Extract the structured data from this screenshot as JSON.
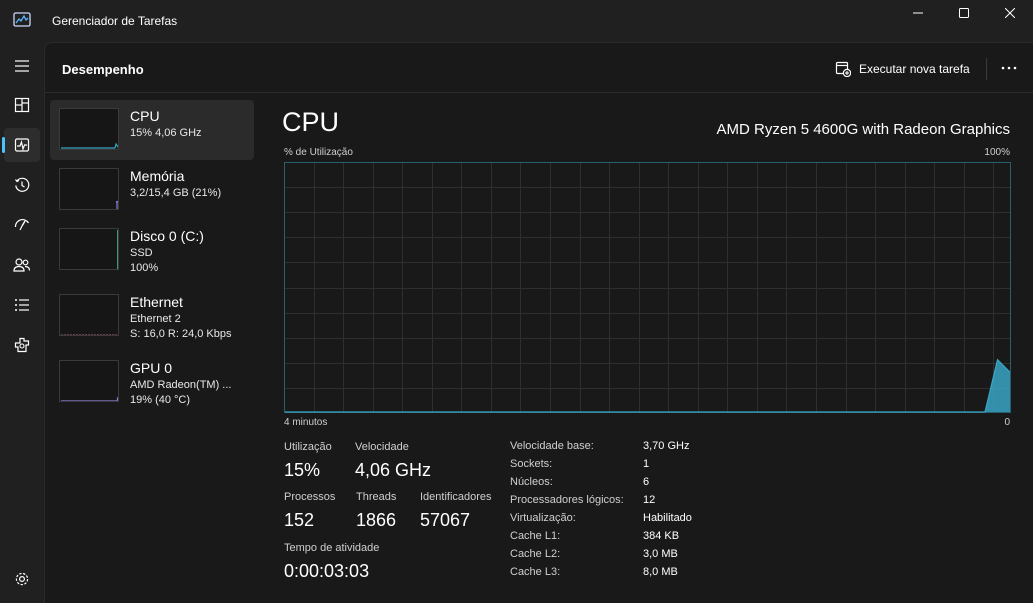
{
  "window": {
    "title": "Gerenciador de Tarefas",
    "icons": {
      "app": "task-manager-icon",
      "minimize": "minimize-icon",
      "maximize": "maximize-icon",
      "close": "close-icon"
    }
  },
  "rail": {
    "icons": [
      "hamburger-menu-icon",
      "processes-icon",
      "performance-icon",
      "app-history-icon",
      "startup-apps-icon",
      "users-icon",
      "details-icon",
      "services-icon",
      "settings-icon"
    ],
    "active": "performance"
  },
  "header": {
    "title": "Desempenho",
    "run_new_task": "Executar nova tarefa",
    "more": "more-options-icon"
  },
  "devices": [
    {
      "name": "CPU",
      "line1": "15% 4,06 GHz",
      "line2": "",
      "color": "#3aa5c4"
    },
    {
      "name": "Memória",
      "line1": "3,2/15,4 GB (21%)",
      "line2": "",
      "color": "#8f80e0"
    },
    {
      "name": "Disco 0 (C:)",
      "line1": "SSD",
      "line2": "100%",
      "color": "#49b89c"
    },
    {
      "name": "Ethernet",
      "line1": "Ethernet 2",
      "line2": "S: 16,0 R: 24,0 Kbps",
      "color": "#c25a8e"
    },
    {
      "name": "GPU 0",
      "line1": "AMD Radeon(TM) ...",
      "line2": "19% (40 °C)",
      "color": "#8f80e0"
    }
  ],
  "cpu": {
    "title": "CPU",
    "model": "AMD Ryzen 5 4600G with Radeon Graphics",
    "util_label": "% de Utilização",
    "util_max": "100%",
    "time_left": "4 minutos",
    "time_right": "0",
    "graph_color": "#3aa5c4",
    "utilization_history": [
      0,
      0,
      0,
      0,
      0,
      0,
      0,
      0,
      0,
      0,
      0,
      0,
      0,
      0,
      0,
      0,
      0,
      0,
      0,
      0,
      0,
      0,
      0,
      0,
      0,
      0,
      0,
      0,
      0,
      0,
      0,
      0,
      0,
      0,
      0,
      0,
      0,
      0,
      0,
      0,
      0,
      0,
      0,
      0,
      0,
      0,
      0,
      0,
      0,
      0,
      0,
      0,
      0,
      0,
      0,
      0,
      0,
      21,
      16
    ],
    "stats": {
      "utilization_label": "Utilização",
      "utilization": "15%",
      "speed_label": "Velocidade",
      "speed": "4,06 GHz",
      "processes_label": "Processos",
      "processes": "152",
      "threads_label": "Threads",
      "threads": "1866",
      "handles_label": "Identificadores",
      "handles": "57067",
      "uptime_label": "Tempo de atividade",
      "uptime": "0:00:03:03"
    },
    "specs": [
      {
        "k": "Velocidade base:",
        "v": "3,70 GHz"
      },
      {
        "k": "Sockets:",
        "v": "1"
      },
      {
        "k": "Núcleos:",
        "v": "6"
      },
      {
        "k": "Processadores lógicos:",
        "v": "12"
      },
      {
        "k": "Virtualização:",
        "v": "Habilitado"
      },
      {
        "k": "Cache L1:",
        "v": "384 KB"
      },
      {
        "k": "Cache L2:",
        "v": "3,0 MB"
      },
      {
        "k": "Cache L3:",
        "v": "8,0 MB"
      }
    ]
  }
}
